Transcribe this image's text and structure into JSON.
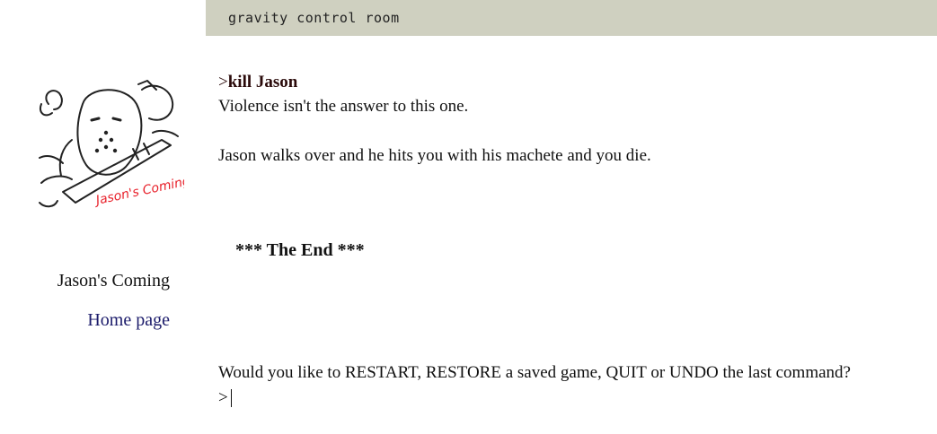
{
  "status_bar": {
    "location": "gravity control room"
  },
  "sidebar": {
    "cover_art_text": "Jason's Coming",
    "game_title": "Jason's Coming",
    "home_link": "Home page"
  },
  "transcript": {
    "prompt_symbol": ">",
    "command": "kill Jason",
    "response_1": "Violence isn't the answer to this one.",
    "response_2": "Jason walks over and he hits you with his machete and you die.",
    "end_text": "*** The End ***",
    "final_question": "Would you like to RESTART, RESTORE a saved game, QUIT or UNDO the last command?"
  },
  "input": {
    "prompt": ">",
    "value": ""
  },
  "colors": {
    "status_bar_bg": "#cfd0c0",
    "link": "#1a1a6a",
    "art_accent": "#e8202a"
  },
  "icons": {
    "cover_art": "jason-mask-machete-drawing"
  }
}
